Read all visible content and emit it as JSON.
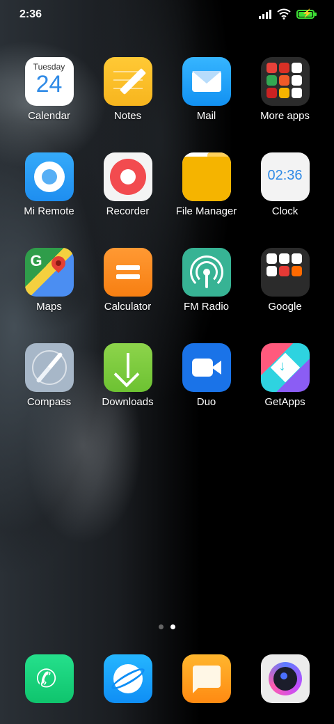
{
  "status_bar": {
    "time": "2:36"
  },
  "apps": [
    {
      "label": "Calendar",
      "weekday": "Tuesday",
      "day": "24"
    },
    {
      "label": "Notes"
    },
    {
      "label": "Mail"
    },
    {
      "label": "More apps"
    },
    {
      "label": "Mi Remote"
    },
    {
      "label": "Recorder"
    },
    {
      "label": "File Manager"
    },
    {
      "label": "Clock",
      "digits": "02:36"
    },
    {
      "label": "Maps"
    },
    {
      "label": "Calculator"
    },
    {
      "label": "FM Radio"
    },
    {
      "label": "Google"
    },
    {
      "label": "Compass"
    },
    {
      "label": "Downloads"
    },
    {
      "label": "Duo"
    },
    {
      "label": "GetApps"
    }
  ],
  "page_indicator": {
    "pages": 2,
    "active": 2
  },
  "dock": [
    {
      "name": "phone"
    },
    {
      "name": "browser"
    },
    {
      "name": "messages"
    },
    {
      "name": "camera"
    }
  ],
  "colors": {
    "accent_blue": "#2f8ae6",
    "battery_green": "#3ddc35"
  }
}
